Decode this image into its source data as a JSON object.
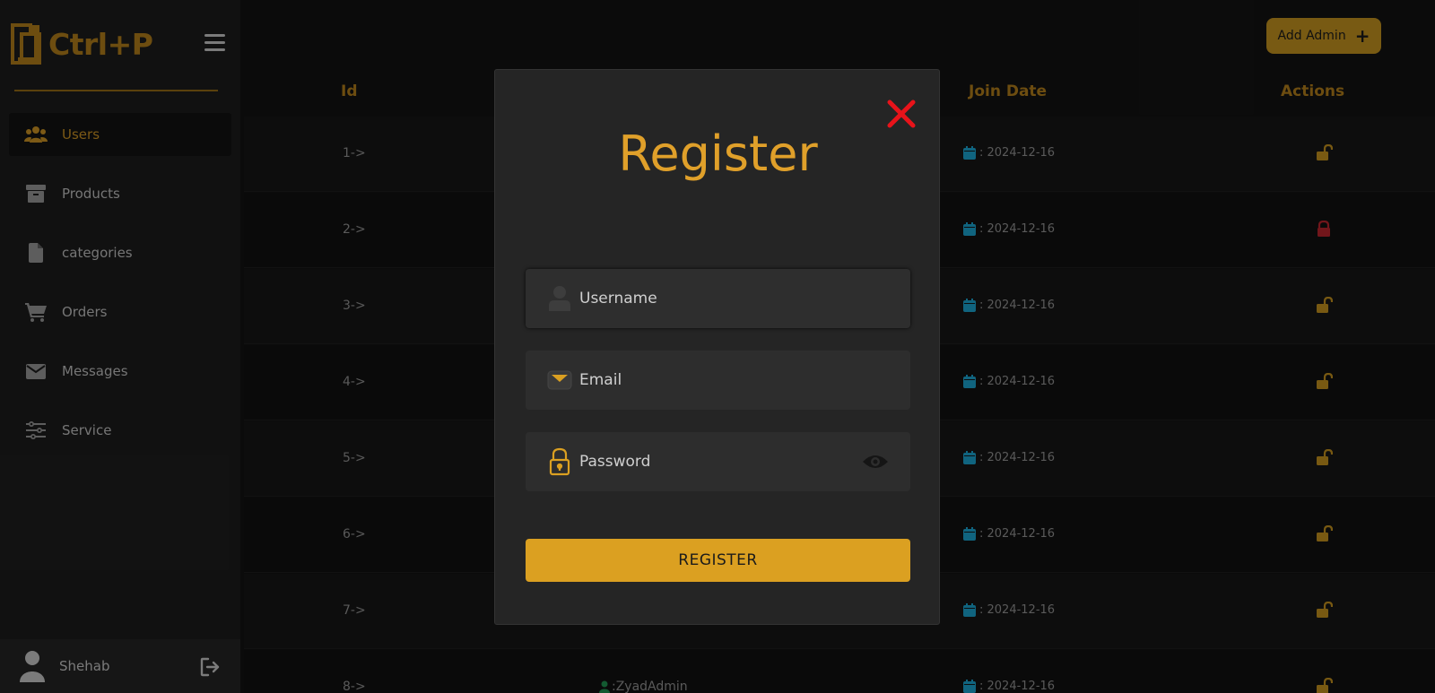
{
  "brand": {
    "name": "Ctrl+P"
  },
  "sidebar": {
    "items": [
      {
        "label": "Users",
        "icon": "users-icon",
        "active": true
      },
      {
        "label": "Products",
        "icon": "archive-box-icon"
      },
      {
        "label": "categories",
        "icon": "file-icon"
      },
      {
        "label": "Orders",
        "icon": "cart-icon"
      },
      {
        "label": "Messages",
        "icon": "envelope-icon"
      },
      {
        "label": "Service",
        "icon": "sliders-icon"
      }
    ],
    "user": {
      "name": "Shehab"
    }
  },
  "header": {
    "add_admin_label": "Add Admin",
    "add_admin_icon": "+"
  },
  "table": {
    "columns": {
      "id": "Id",
      "join_date": "Join Date",
      "actions": "Actions"
    },
    "rows": [
      {
        "id": "1->",
        "name": "",
        "date": ": 2024-12-16",
        "locked": false
      },
      {
        "id": "2->",
        "name": "",
        "date": ": 2024-12-16",
        "locked": true
      },
      {
        "id": "3->",
        "name": "",
        "date": ": 2024-12-16",
        "locked": false
      },
      {
        "id": "4->",
        "name": "",
        "date": ": 2024-12-16",
        "locked": false
      },
      {
        "id": "5->",
        "name": "",
        "date": ": 2024-12-16",
        "locked": false
      },
      {
        "id": "6->",
        "name": "",
        "date": ": 2024-12-16",
        "locked": false
      },
      {
        "id": "7->",
        "name": "",
        "date": ": 2024-12-16",
        "locked": false
      },
      {
        "id": "8->",
        "name": ":ZyadAdmin",
        "date": ": 2024-12-16",
        "locked": false
      }
    ]
  },
  "modal": {
    "title": "Register",
    "username": {
      "placeholder": "Username",
      "value": ""
    },
    "email": {
      "placeholder": "Email",
      "value": ""
    },
    "password": {
      "placeholder": "Password",
      "value": ""
    },
    "submit_label": "REGISTER"
  },
  "colors": {
    "accent": "#dba021",
    "brand_dark": "#a8771a",
    "close": "#e8131a",
    "calendar": "#1a9ac4",
    "unlock": "#b8891c",
    "lock": "#b0222a",
    "user_green": "#1e8a4c"
  }
}
